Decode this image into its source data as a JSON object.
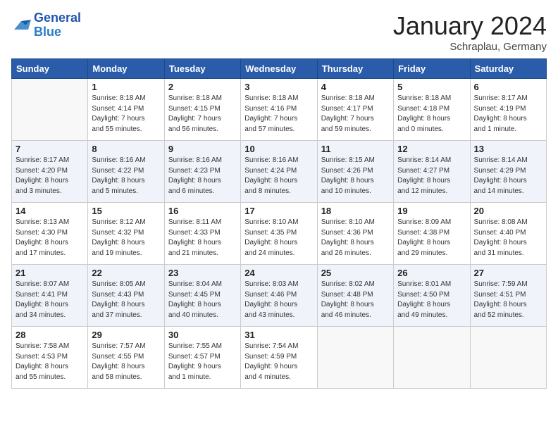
{
  "logo": {
    "line1": "General",
    "line2": "Blue"
  },
  "title": "January 2024",
  "subtitle": "Schraplau, Germany",
  "headers": [
    "Sunday",
    "Monday",
    "Tuesday",
    "Wednesday",
    "Thursday",
    "Friday",
    "Saturday"
  ],
  "weeks": [
    [
      {
        "day": "",
        "info": ""
      },
      {
        "day": "1",
        "info": "Sunrise: 8:18 AM\nSunset: 4:14 PM\nDaylight: 7 hours\nand 55 minutes."
      },
      {
        "day": "2",
        "info": "Sunrise: 8:18 AM\nSunset: 4:15 PM\nDaylight: 7 hours\nand 56 minutes."
      },
      {
        "day": "3",
        "info": "Sunrise: 8:18 AM\nSunset: 4:16 PM\nDaylight: 7 hours\nand 57 minutes."
      },
      {
        "day": "4",
        "info": "Sunrise: 8:18 AM\nSunset: 4:17 PM\nDaylight: 7 hours\nand 59 minutes."
      },
      {
        "day": "5",
        "info": "Sunrise: 8:18 AM\nSunset: 4:18 PM\nDaylight: 8 hours\nand 0 minutes."
      },
      {
        "day": "6",
        "info": "Sunrise: 8:17 AM\nSunset: 4:19 PM\nDaylight: 8 hours\nand 1 minute."
      }
    ],
    [
      {
        "day": "7",
        "info": "Sunrise: 8:17 AM\nSunset: 4:20 PM\nDaylight: 8 hours\nand 3 minutes."
      },
      {
        "day": "8",
        "info": "Sunrise: 8:16 AM\nSunset: 4:22 PM\nDaylight: 8 hours\nand 5 minutes."
      },
      {
        "day": "9",
        "info": "Sunrise: 8:16 AM\nSunset: 4:23 PM\nDaylight: 8 hours\nand 6 minutes."
      },
      {
        "day": "10",
        "info": "Sunrise: 8:16 AM\nSunset: 4:24 PM\nDaylight: 8 hours\nand 8 minutes."
      },
      {
        "day": "11",
        "info": "Sunrise: 8:15 AM\nSunset: 4:26 PM\nDaylight: 8 hours\nand 10 minutes."
      },
      {
        "day": "12",
        "info": "Sunrise: 8:14 AM\nSunset: 4:27 PM\nDaylight: 8 hours\nand 12 minutes."
      },
      {
        "day": "13",
        "info": "Sunrise: 8:14 AM\nSunset: 4:29 PM\nDaylight: 8 hours\nand 14 minutes."
      }
    ],
    [
      {
        "day": "14",
        "info": "Sunrise: 8:13 AM\nSunset: 4:30 PM\nDaylight: 8 hours\nand 17 minutes."
      },
      {
        "day": "15",
        "info": "Sunrise: 8:12 AM\nSunset: 4:32 PM\nDaylight: 8 hours\nand 19 minutes."
      },
      {
        "day": "16",
        "info": "Sunrise: 8:11 AM\nSunset: 4:33 PM\nDaylight: 8 hours\nand 21 minutes."
      },
      {
        "day": "17",
        "info": "Sunrise: 8:10 AM\nSunset: 4:35 PM\nDaylight: 8 hours\nand 24 minutes."
      },
      {
        "day": "18",
        "info": "Sunrise: 8:10 AM\nSunset: 4:36 PM\nDaylight: 8 hours\nand 26 minutes."
      },
      {
        "day": "19",
        "info": "Sunrise: 8:09 AM\nSunset: 4:38 PM\nDaylight: 8 hours\nand 29 minutes."
      },
      {
        "day": "20",
        "info": "Sunrise: 8:08 AM\nSunset: 4:40 PM\nDaylight: 8 hours\nand 31 minutes."
      }
    ],
    [
      {
        "day": "21",
        "info": "Sunrise: 8:07 AM\nSunset: 4:41 PM\nDaylight: 8 hours\nand 34 minutes."
      },
      {
        "day": "22",
        "info": "Sunrise: 8:05 AM\nSunset: 4:43 PM\nDaylight: 8 hours\nand 37 minutes."
      },
      {
        "day": "23",
        "info": "Sunrise: 8:04 AM\nSunset: 4:45 PM\nDaylight: 8 hours\nand 40 minutes."
      },
      {
        "day": "24",
        "info": "Sunrise: 8:03 AM\nSunset: 4:46 PM\nDaylight: 8 hours\nand 43 minutes."
      },
      {
        "day": "25",
        "info": "Sunrise: 8:02 AM\nSunset: 4:48 PM\nDaylight: 8 hours\nand 46 minutes."
      },
      {
        "day": "26",
        "info": "Sunrise: 8:01 AM\nSunset: 4:50 PM\nDaylight: 8 hours\nand 49 minutes."
      },
      {
        "day": "27",
        "info": "Sunrise: 7:59 AM\nSunset: 4:51 PM\nDaylight: 8 hours\nand 52 minutes."
      }
    ],
    [
      {
        "day": "28",
        "info": "Sunrise: 7:58 AM\nSunset: 4:53 PM\nDaylight: 8 hours\nand 55 minutes."
      },
      {
        "day": "29",
        "info": "Sunrise: 7:57 AM\nSunset: 4:55 PM\nDaylight: 8 hours\nand 58 minutes."
      },
      {
        "day": "30",
        "info": "Sunrise: 7:55 AM\nSunset: 4:57 PM\nDaylight: 9 hours\nand 1 minute."
      },
      {
        "day": "31",
        "info": "Sunrise: 7:54 AM\nSunset: 4:59 PM\nDaylight: 9 hours\nand 4 minutes."
      },
      {
        "day": "",
        "info": ""
      },
      {
        "day": "",
        "info": ""
      },
      {
        "day": "",
        "info": ""
      }
    ]
  ]
}
